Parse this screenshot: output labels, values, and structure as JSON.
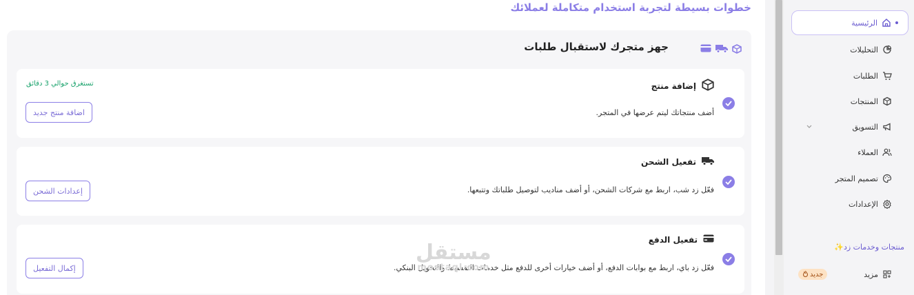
{
  "header": {
    "title": "خطوات بسيطة لتجربة استخدام متكاملة لعملائك"
  },
  "setup": {
    "title": "جهز متجرك لاستقبال طلبات",
    "steps": [
      {
        "title": "إضافة منتج",
        "description": "أضف منتجاتك ليتم عرضها في المتجر.",
        "button": "اضافة منتج جديد",
        "time": "تستغرق حوالي 3 دقائق",
        "icon": "box-icon"
      },
      {
        "title": "تفعيل الشحن",
        "description": "فعّل زد شب، اربط مع شركات الشحن، أو أضف مناديب لتوصيل طلباتك وتتبعها.",
        "button": "إعدادات الشحن",
        "icon": "truck-icon"
      },
      {
        "title": "تفعيل الدفع",
        "description": "فعّل زد باي، اربط مع بوابات الدفع، أو أضف خيارات أخرى للدفع مثل خدمات التقسيط والتحويل البنكي.",
        "button": "إكمال التفعيل",
        "icon": "card-icon"
      }
    ]
  },
  "sidebar": {
    "items": [
      {
        "label": "الرئيسية",
        "icon": "home-icon"
      },
      {
        "label": "التحليلات",
        "icon": "pie-icon"
      },
      {
        "label": "الطلبات",
        "icon": "cart-icon"
      },
      {
        "label": "المنتجات",
        "icon": "box-icon"
      },
      {
        "label": "التسويق",
        "icon": "megaphone-icon"
      },
      {
        "label": "العملاء",
        "icon": "users-icon"
      },
      {
        "label": "تصميم المتجر",
        "icon": "palette-icon"
      },
      {
        "label": "الإعدادات",
        "icon": "gear-icon"
      }
    ],
    "section_label": "منتجات وخدمات زد✨",
    "more_label": "مزيد",
    "new_badge": "جديد"
  },
  "watermark": {
    "ar": "مستقل",
    "en": "mostaql.com"
  },
  "colors": {
    "accent": "#8b7ee6",
    "success": "#18a26b",
    "badge_bg": "#fde2c4"
  }
}
